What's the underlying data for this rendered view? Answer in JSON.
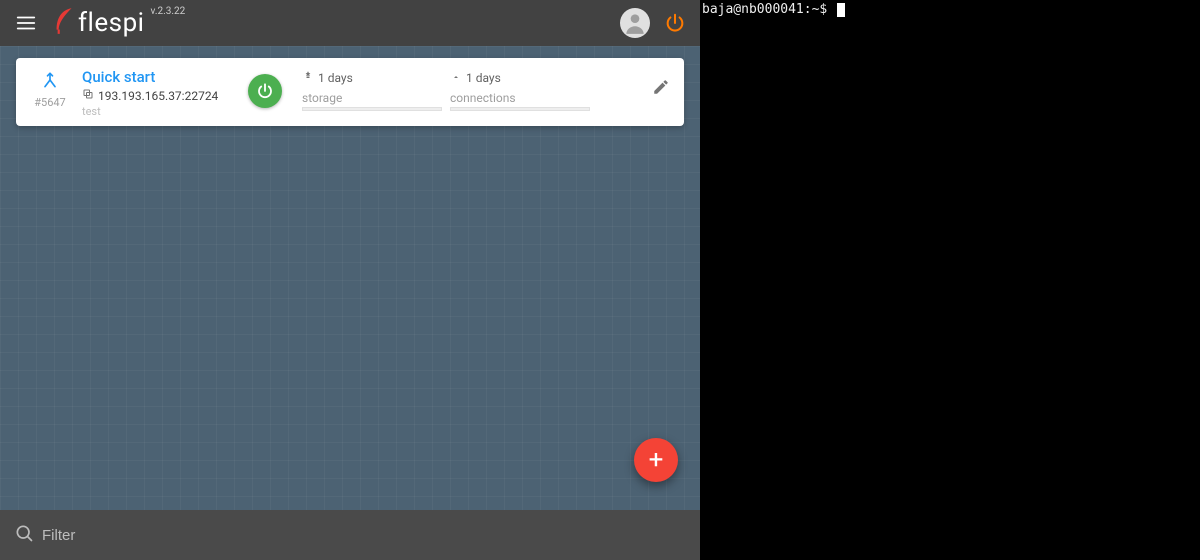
{
  "brand": {
    "name": "flespi",
    "version": "v.2.3.22"
  },
  "card": {
    "id_label": "#5647",
    "title": "Quick start",
    "address": "193.193.165.37:22724",
    "subtitle": "test",
    "metric1": {
      "value": "1 days",
      "label": "storage"
    },
    "metric2": {
      "value": "1 days",
      "label": "connections"
    }
  },
  "filter": {
    "placeholder": "Filter"
  },
  "terminal": {
    "prompt": "baja@nb000041:~$ "
  },
  "colors": {
    "accent_blue": "#2196f3",
    "accent_green": "#4caf50",
    "accent_red": "#f44336",
    "accent_orange": "#ff7a00"
  }
}
